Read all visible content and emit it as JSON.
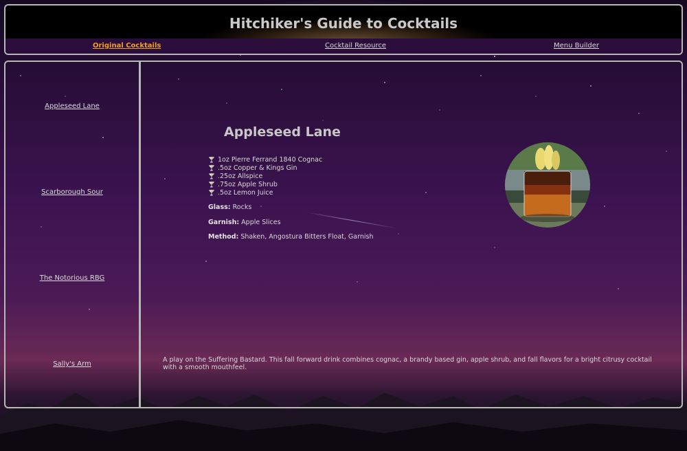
{
  "site": {
    "title": "Hitchiker's Guide to Cocktails"
  },
  "nav": [
    {
      "label": "Original Cocktails",
      "active": true
    },
    {
      "label": "Cocktail Resource",
      "active": false
    },
    {
      "label": "Menu Builder",
      "active": false
    }
  ],
  "sidebar": {
    "items": [
      {
        "label": "Appleseed Lane"
      },
      {
        "label": "Scarborough Sour"
      },
      {
        "label": "The Notorious RBG"
      },
      {
        "label": "Sally's Arm"
      }
    ]
  },
  "drink": {
    "title": "Appleseed Lane",
    "ingredients": [
      "1oz Pierre Ferrand 1840 Cognac",
      ".5oz Copper & Kings Gin",
      ".25oz Allspice",
      ".75oz Apple Shrub",
      ".5oz Lemon Juice"
    ],
    "glass_label": "Glass:",
    "glass": "Rocks",
    "garnish_label": "Garnish:",
    "garnish": "Apple Slices",
    "method_label": "Method:",
    "method": "Shaken, Angostura Bitters Float, Garnish",
    "description": "A play on the Suffering Bastard. This fall forward drink combines cognac, a brandy based gin, apple shrub, and fall flavors for a bright citrusy cocktail with a smooth mouthfeel."
  },
  "icons": {
    "bullet": "martini-glass-icon"
  },
  "colors": {
    "active_nav": "#f0a020",
    "border": "#b8b8b8",
    "nav_bg": "#2a0d3a"
  }
}
